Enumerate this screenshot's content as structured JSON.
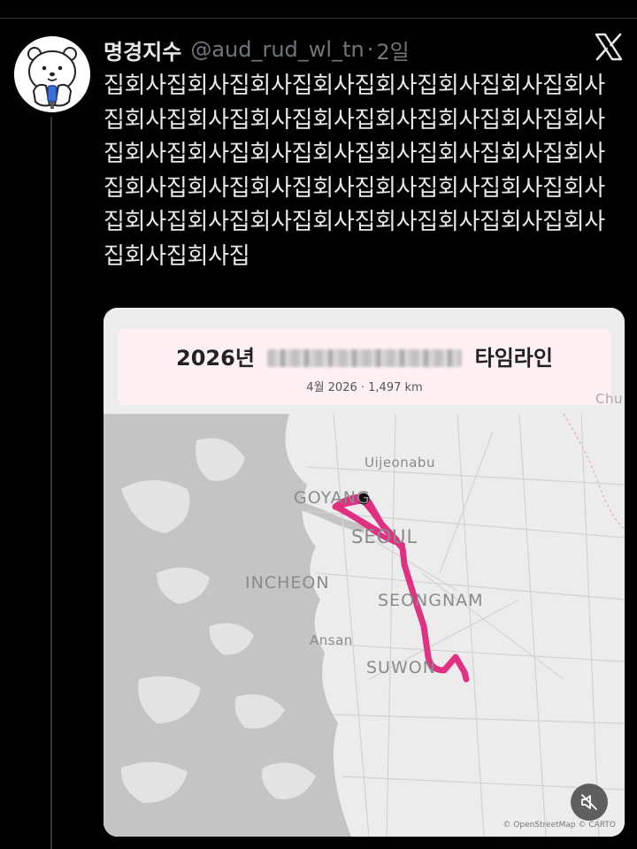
{
  "tweet": {
    "display_name": "명경지수",
    "handle": "@aud_rud_wl_tn",
    "dot": "·",
    "time": "2일",
    "text": "집회사집회사집회사집회사집회사집회사집회사집회사집회사집회사집회사집회사집회사집회사집회사집회사집회사집회사집회사집회사집회사집회사집회사집회사집회사집회사집회사집회사집회사집회사집회사집회사집회사집회사집회사집회사집회사집회사집회사집회사집회사집회사집"
  },
  "map_card": {
    "title_prefix": "2026년",
    "title_suffix": "타임라인",
    "subtitle": "4월 2026  ·  1,497 km",
    "cities": {
      "uijeongbu": "Uijeonabu",
      "goyang": "GOYANG",
      "seoul": "SEOUL",
      "incheon": "INCHEON",
      "seongnam": "SEONGNAM",
      "ansan": "Ansan",
      "suwon": "SUWON",
      "chu": "Chu"
    },
    "attribution": "© OpenStreetMap  © CARTO",
    "route_color": "#e0217a"
  },
  "icons": {
    "logo": "x-logo-icon",
    "mute": "volume-muted-icon"
  }
}
